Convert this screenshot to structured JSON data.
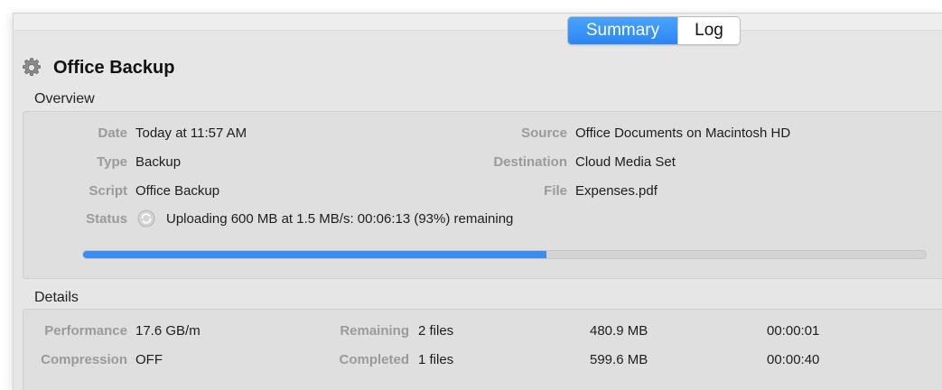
{
  "tabs": {
    "summary": "Summary",
    "log": "Log"
  },
  "title": "Office Backup",
  "overview": {
    "heading": "Overview",
    "date_label": "Date",
    "date": "Today at 11:57 AM",
    "type_label": "Type",
    "type": "Backup",
    "script_label": "Script",
    "script": "Office Backup",
    "status_label": "Status",
    "status": "Uploading 600 MB at 1.5 MB/s: 00:06:13 (93%) remaining",
    "source_label": "Source",
    "source": "Office Documents on Macintosh HD",
    "destination_label": "Destination",
    "destination": "Cloud Media Set",
    "file_label": "File",
    "file": "Expenses.pdf",
    "progress_fraction": 0.55
  },
  "details": {
    "heading": "Details",
    "performance_label": "Performance",
    "performance": "17.6 GB/m",
    "compression_label": "Compression",
    "compression": "OFF",
    "remaining_label": "Remaining",
    "remaining_files": "2 files",
    "remaining_size": "480.9 MB",
    "remaining_time": "00:00:01",
    "completed_label": "Completed",
    "completed_files": "1 files",
    "completed_size": "599.6 MB",
    "completed_time": "00:00:40"
  },
  "icons": {
    "title": "gear-icon",
    "status": "sync-icon"
  },
  "colors": {
    "accent": "#2b86f4",
    "progress": "#3a8df0"
  }
}
